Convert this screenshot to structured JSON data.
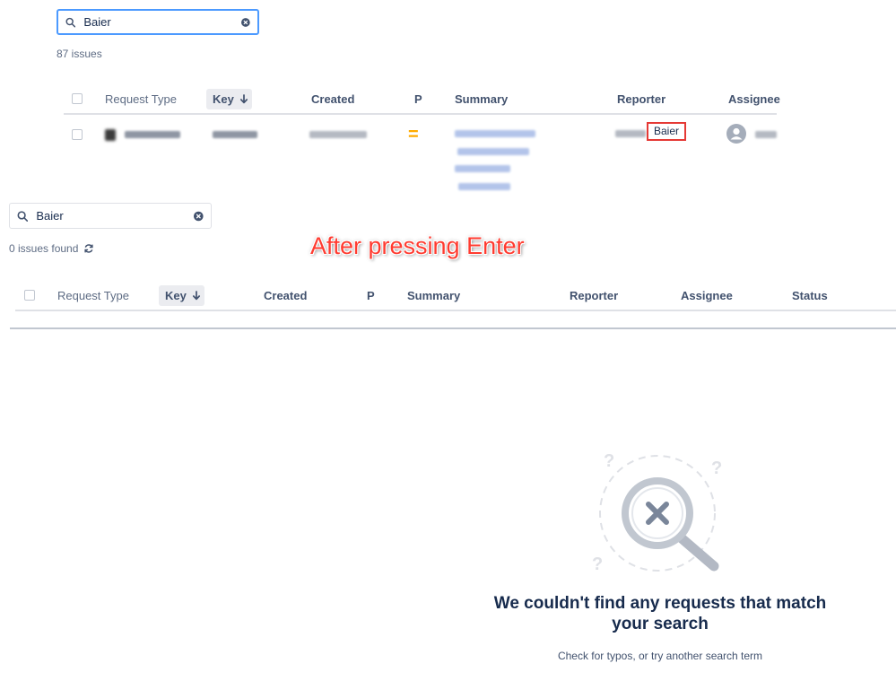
{
  "top_panel": {
    "search": {
      "value": "Baier",
      "placeholder": ""
    },
    "issue_count": "87 issues",
    "columns": {
      "request_type": "Request Type",
      "key": "Key",
      "created": "Created",
      "priority": "P",
      "summary": "Summary",
      "reporter": "Reporter",
      "assignee": "Assignee"
    },
    "row": {
      "priority_glyph": "=",
      "reporter_highlight": "Baier"
    },
    "colors": {
      "focus_border": "#4c9aff",
      "priority_medium": "#ffab00",
      "highlight_box": "#e53935"
    }
  },
  "annotation": {
    "text": "After pressing Enter",
    "color": "#ff3b30"
  },
  "bottom_panel": {
    "search": {
      "value": "Baier",
      "placeholder": ""
    },
    "issue_count": "0 issues found",
    "columns": {
      "request_type": "Request Type",
      "key": "Key",
      "created": "Created",
      "priority": "P",
      "summary": "Summary",
      "reporter": "Reporter",
      "assignee": "Assignee",
      "status": "Status"
    },
    "empty_state": {
      "title": "We couldn't find any requests that match your search",
      "subtitle": "Check for typos, or try another search term",
      "illustration": "magnifier-x-icon"
    }
  }
}
